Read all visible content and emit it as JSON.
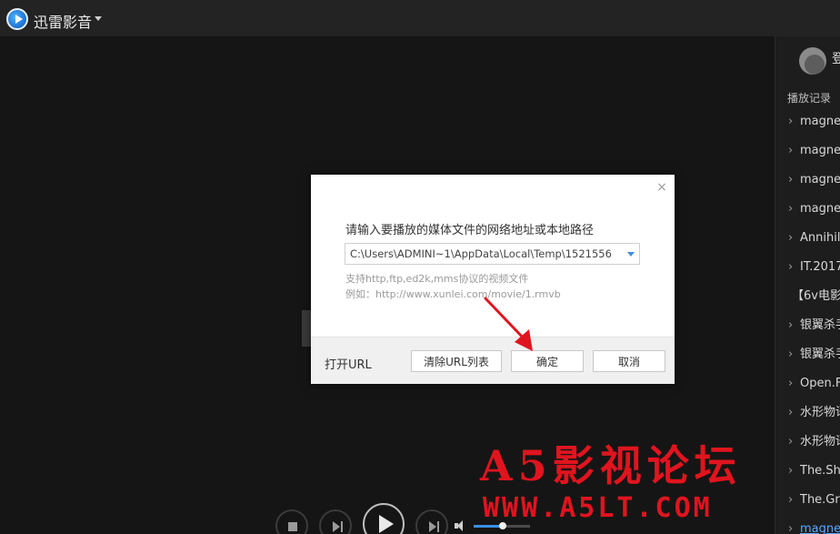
{
  "titlebar": {
    "app_name": "迅雷影音"
  },
  "sidebar": {
    "login_label": "登",
    "history_title": "播放记录",
    "items": [
      {
        "label": "magne",
        "arrow": true
      },
      {
        "label": "magne",
        "arrow": true
      },
      {
        "label": "magne",
        "arrow": true
      },
      {
        "label": "magne",
        "arrow": true
      },
      {
        "label": "Annihil",
        "arrow": true
      },
      {
        "label": "IT.2017",
        "arrow": true
      },
      {
        "label": "【6v电影",
        "arrow": false
      },
      {
        "label": "银翼杀手",
        "arrow": true
      },
      {
        "label": "银翼杀手",
        "arrow": true
      },
      {
        "label": "Open.F",
        "arrow": true
      },
      {
        "label": "水形物语",
        "arrow": true
      },
      {
        "label": "水形物语",
        "arrow": true
      },
      {
        "label": "The.Sh",
        "arrow": true
      },
      {
        "label": "The.Gr",
        "arrow": true
      },
      {
        "label": "magne",
        "arrow": true
      }
    ]
  },
  "dialog": {
    "prompt": "请输入要播放的媒体文件的网络地址或本地路径",
    "url_value": "C:\\Users\\ADMINI~1\\AppData\\Local\\Temp\\1521556",
    "hint_protocols": "支持http,ftp,ed2k,mms协议的视频文件",
    "hint_example": "例如：http://www.xunlei.com/movie/1.rmvb",
    "footer_label": "打开URL",
    "clear_label": "清除URL列表",
    "ok_label": "确定",
    "cancel_label": "取消",
    "close_glyph": "×"
  },
  "controls": {
    "volume_level": 0.52
  },
  "watermark": {
    "line1": "A5影视论坛",
    "line2": "WWW.A5LT.COM"
  },
  "colors": {
    "accent": "#3a8fe8",
    "watermark": "#e0141e",
    "arrow": "#e0141e"
  }
}
